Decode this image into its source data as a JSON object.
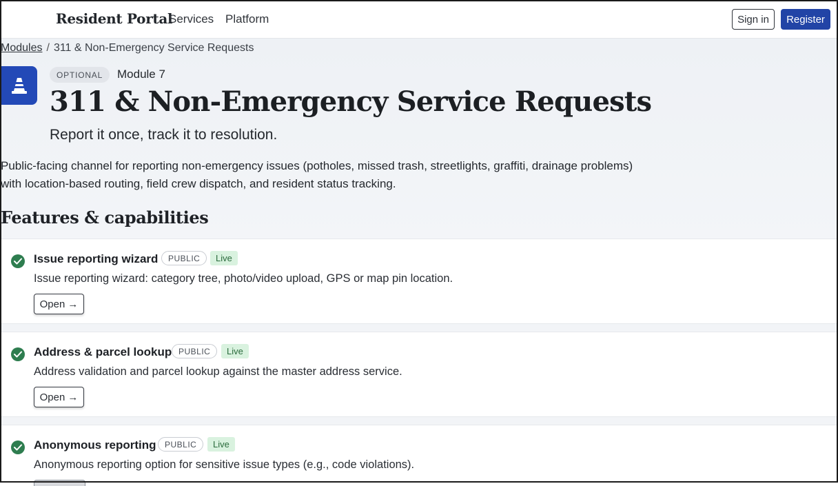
{
  "nav": {
    "brand": "Resident Portal",
    "links": [
      "Services",
      "Platform"
    ],
    "signin_label": "Sign in",
    "register_label": "Register"
  },
  "breadcrumb": {
    "root": "Modules",
    "separator": "/",
    "current": "311 & Non-Emergency Service Requests"
  },
  "module": {
    "icon": "traffic-cone-icon",
    "badge": "OPTIONAL",
    "number_label": "Module 7",
    "title": "311 & Non-Emergency Service Requests",
    "tagline": "Report it once, track it to resolution.",
    "description": "Public-facing channel for reporting non-emergency issues (potholes, missed trash, streetlights, graffiti, drainage problems) with location-based routing, field crew dispatch, and resident status tracking."
  },
  "features_heading": "Features & capabilities",
  "features": [
    {
      "title": "Issue reporting wizard",
      "audience": "PUBLIC",
      "status": "Live",
      "description": "Issue reporting wizard: category tree, photo/video upload, GPS or map pin location.",
      "action_label": "Open"
    },
    {
      "title": "Address & parcel lookup",
      "audience": "PUBLIC",
      "status": "Live",
      "description": "Address validation and parcel lookup against the master address service.",
      "action_label": "Open"
    },
    {
      "title": "Anonymous reporting",
      "audience": "PUBLIC",
      "status": "Live",
      "description": "Anonymous reporting option for sensitive issue types (e.g., code violations)."
    }
  ],
  "colors": {
    "accent": "#2244a6",
    "success": "#2e7d4f",
    "live_bg": "#d9f2df"
  }
}
